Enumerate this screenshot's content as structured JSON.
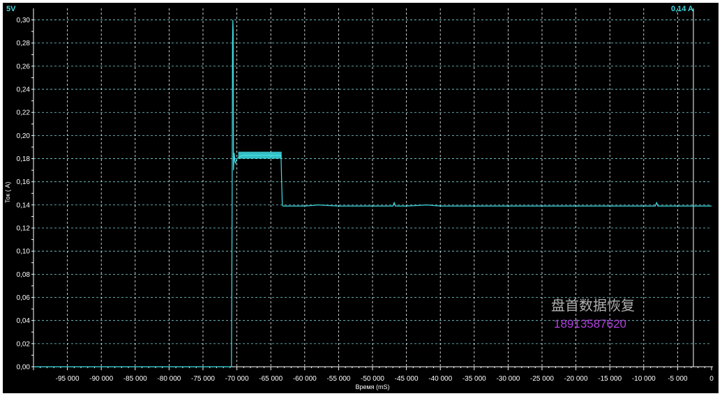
{
  "chart_data": {
    "type": "line",
    "corner_left": "5V",
    "corner_right": "0,14 A",
    "xlabel": "Время (mS)",
    "ylabel": "Ток ( A)",
    "xlim": [
      -100000,
      0
    ],
    "ylim": [
      0,
      0.31
    ],
    "grid": true,
    "x_ticks": [
      -95000,
      -90000,
      -85000,
      -80000,
      -75000,
      -70000,
      -65000,
      -60000,
      -55000,
      -50000,
      -45000,
      -40000,
      -35000,
      -30000,
      -25000,
      -20000,
      -15000,
      -10000,
      -5000,
      0
    ],
    "x_tick_labels": [
      "-95 000",
      "-90 000",
      "-85 000",
      "-80 000",
      "-75 000",
      "-70 000",
      "-65 000",
      "-60 000",
      "-55 000",
      "-50 000",
      "-45 000",
      "-40 000",
      "-35 000",
      "-30 000",
      "-25 000",
      "-20 000",
      "-15 000",
      "-10 000",
      "-5 000",
      "0"
    ],
    "y_ticks": [
      0,
      0.02,
      0.04,
      0.06,
      0.08,
      0.1,
      0.12,
      0.14,
      0.16,
      0.18,
      0.2,
      0.22,
      0.24,
      0.26,
      0.28,
      0.3
    ],
    "y_tick_labels": [
      "0,00",
      "0,02",
      "0,04",
      "0,06",
      "0,08",
      "0,10",
      "0,12",
      "0,14",
      "0,16",
      "0,18",
      "0,20",
      "0,22",
      "0,24",
      "0,26",
      "0,28",
      "0,30"
    ],
    "series": [
      {
        "color": "#40e0e8",
        "x": [
          -100000,
          -70800,
          -70750,
          -70700,
          -70650,
          -70600,
          -70550,
          -70500,
          -70400,
          -70300,
          -70200,
          -70000,
          -69500,
          -69000,
          -67000,
          -65000,
          -63500,
          -63350,
          -63300,
          -63200,
          -60000,
          -58000,
          -55000,
          -50000,
          -47000,
          -46800,
          -46600,
          -45000,
          -42000,
          -40000,
          -35000,
          -30000,
          -25000,
          -20000,
          -15000,
          -10000,
          -8300,
          -8100,
          -7900,
          -5000,
          0
        ],
        "y": [
          0,
          0,
          0.07,
          0.15,
          0.28,
          0.3,
          0.29,
          0.17,
          0.185,
          0.178,
          0.176,
          0.18,
          0.182,
          0.183,
          0.183,
          0.183,
          0.183,
          0.15,
          0.14,
          0.139,
          0.139,
          0.14,
          0.139,
          0.139,
          0.139,
          0.142,
          0.139,
          0.139,
          0.14,
          0.139,
          0.139,
          0.139,
          0.139,
          0.139,
          0.139,
          0.139,
          0.139,
          0.142,
          0.139,
          0.139,
          0.139
        ]
      }
    ]
  },
  "watermark": {
    "line1": "盘首数据恢复",
    "line2": "18913587620"
  }
}
